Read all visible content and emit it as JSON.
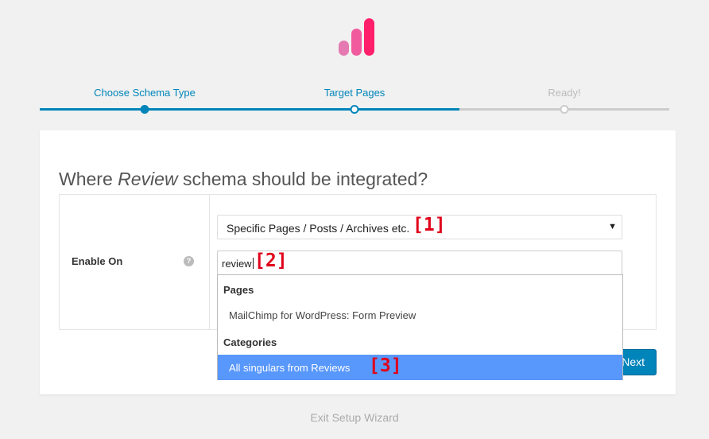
{
  "steps": [
    {
      "label": "Choose Schema Type",
      "status": "done"
    },
    {
      "label": "Target Pages",
      "status": "current"
    },
    {
      "label": "Ready!",
      "status": "upcoming"
    }
  ],
  "progress": 0.67,
  "card": {
    "title_pre": "Where ",
    "title_em": "Review",
    "title_post": " schema should be integrated?",
    "field_label": "Enable On",
    "help_glyph": "?",
    "select_value": "Specific Pages / Posts / Archives etc.",
    "search_value": "review",
    "next_label": "Next"
  },
  "dropdown": {
    "groups": [
      {
        "label": "Pages",
        "options": [
          "MailChimp for WordPress: Form Preview"
        ]
      },
      {
        "label": "Categories",
        "options": [
          "All singulars from Reviews"
        ]
      }
    ],
    "active_option": "All singulars from Reviews"
  },
  "markers": [
    "[1]",
    "[2]",
    "[3]"
  ],
  "exit_label": "Exit Setup Wizard",
  "colors": {
    "accent": "#0085ba",
    "highlight": "#5897fb",
    "marker": "#e0001a",
    "logo_light": "#e579b1",
    "logo_dark": "#ff1f6b"
  }
}
